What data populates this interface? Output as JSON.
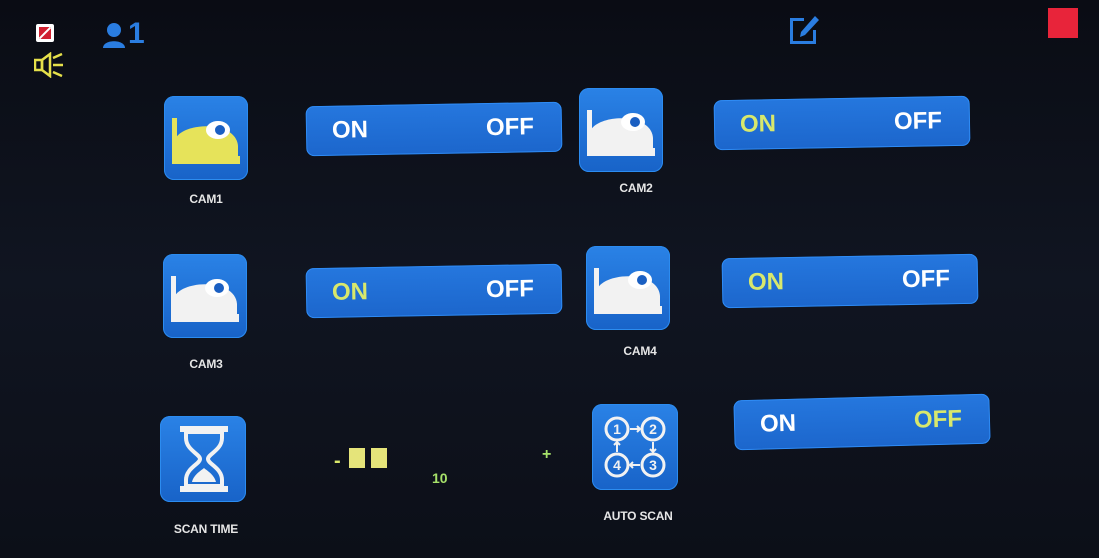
{
  "topbar": {
    "user_count": "1",
    "icons": [
      "no-signal-icon",
      "speaker-icon",
      "user-icon",
      "edit-icon",
      "record-indicator"
    ]
  },
  "cameras": [
    {
      "label": "CAM1",
      "toggle_on": "ON",
      "toggle_off": "OFF",
      "selected": "ON"
    },
    {
      "label": "CAM2",
      "toggle_on": "ON",
      "toggle_off": "OFF",
      "selected": "ON"
    },
    {
      "label": "CAM3",
      "toggle_on": "ON",
      "toggle_off": "OFF",
      "selected": "ON"
    },
    {
      "label": "CAM4",
      "toggle_on": "ON",
      "toggle_off": "OFF",
      "selected": "ON"
    }
  ],
  "scan_time": {
    "label": "SCAN TIME",
    "minus": "-",
    "plus": "+",
    "value": "10"
  },
  "auto_scan": {
    "label": "AUTO SCAN",
    "toggle_on": "ON",
    "toggle_off": "OFF",
    "selected": "OFF"
  },
  "colors": {
    "active_text": "#d8e86c",
    "inactive_text": "#ffffff",
    "tile_blue": "#2a82e6",
    "record_red": "#e8243a",
    "user_blue": "#2a7de1"
  }
}
